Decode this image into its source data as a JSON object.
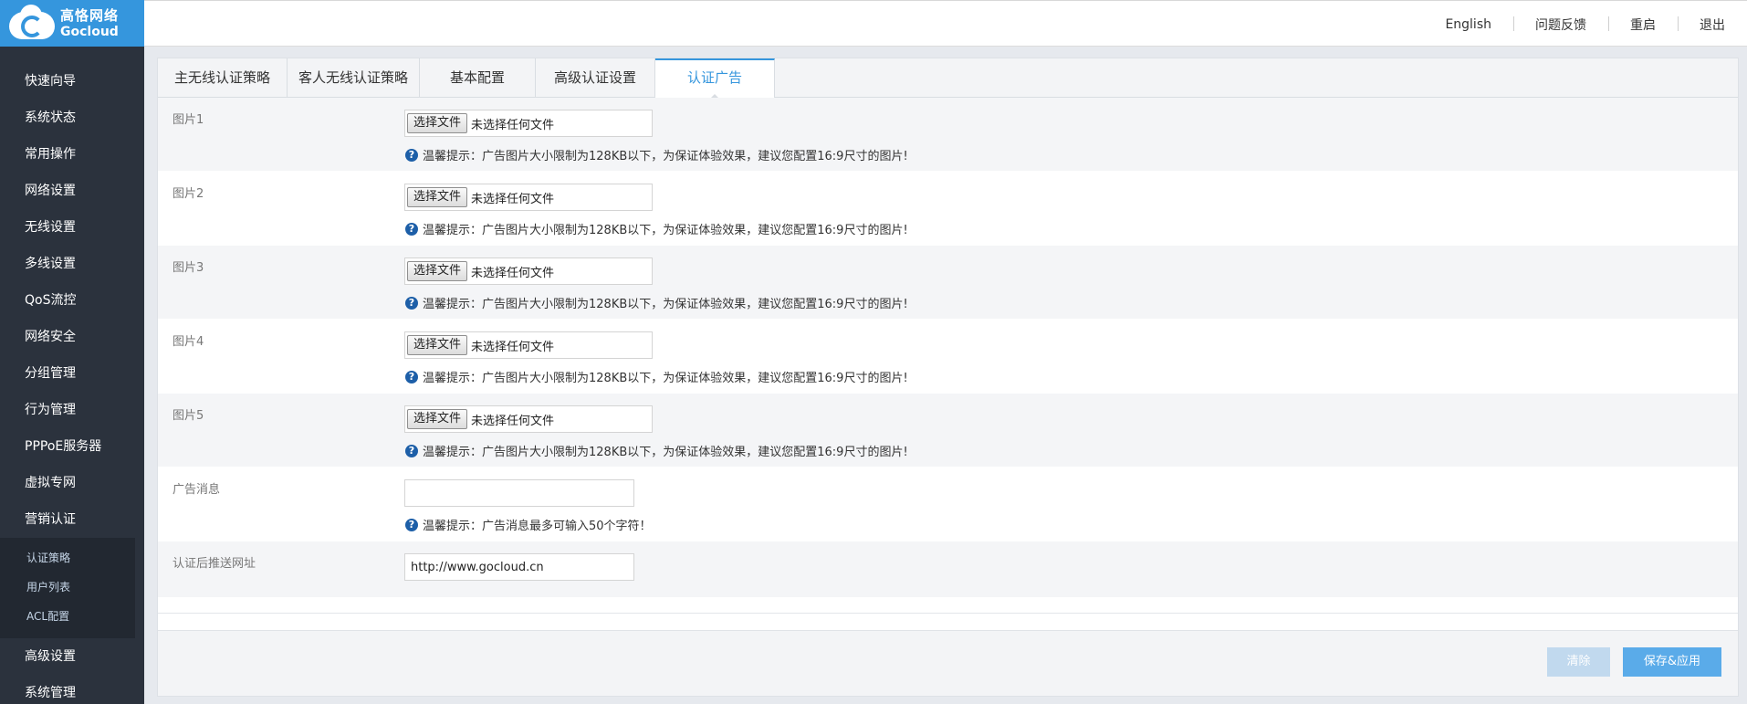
{
  "brand": {
    "name_cn": "高恪网络",
    "name_en": "Gocloud"
  },
  "header": {
    "links": [
      "English",
      "问题反馈",
      "重启",
      "退出"
    ]
  },
  "sidebar": {
    "items": [
      "快速向导",
      "系统状态",
      "常用操作",
      "网络设置",
      "无线设置",
      "多线设置",
      "QoS流控",
      "网络安全",
      "分组管理",
      "行为管理",
      "PPPoE服务器",
      "虚拟专网",
      "营销认证"
    ],
    "subitems": [
      "认证策略",
      "用户列表",
      "ACL配置"
    ],
    "items_after": [
      "高级设置",
      "系统管理"
    ]
  },
  "tabs": [
    "主无线认证策略",
    "客人无线认证策略",
    "基本配置",
    "高级认证设置",
    "认证广告"
  ],
  "active_tab": 4,
  "form": {
    "images": [
      {
        "label": "图片1",
        "button": "选择文件",
        "status": "未选择任何文件",
        "hint": "温馨提示：广告图片大小限制为128KB以下，为保证体验效果，建议您配置16:9尺寸的图片!"
      },
      {
        "label": "图片2",
        "button": "选择文件",
        "status": "未选择任何文件",
        "hint": "温馨提示：广告图片大小限制为128KB以下，为保证体验效果，建议您配置16:9尺寸的图片!"
      },
      {
        "label": "图片3",
        "button": "选择文件",
        "status": "未选择任何文件",
        "hint": "温馨提示：广告图片大小限制为128KB以下，为保证体验效果，建议您配置16:9尺寸的图片!"
      },
      {
        "label": "图片4",
        "button": "选择文件",
        "status": "未选择任何文件",
        "hint": "温馨提示：广告图片大小限制为128KB以下，为保证体验效果，建议您配置16:9尺寸的图片!"
      },
      {
        "label": "图片5",
        "button": "选择文件",
        "status": "未选择任何文件",
        "hint": "温馨提示：广告图片大小限制为128KB以下，为保证体验效果，建议您配置16:9尺寸的图片!"
      }
    ],
    "ad_message": {
      "label": "广告消息",
      "value": "",
      "hint": "温馨提示：广告消息最多可输入50个字符！"
    },
    "redirect_url": {
      "label": "认证后推送网址",
      "value": "http://www.gocloud.cn"
    }
  },
  "buttons": {
    "clear": "清除",
    "save": "保存&应用"
  },
  "colors": {
    "accent": "#3596dd",
    "sidebar_bg": "#2b323d",
    "save_btn": "#5aabe9",
    "clear_btn": "#c1d9ee"
  }
}
